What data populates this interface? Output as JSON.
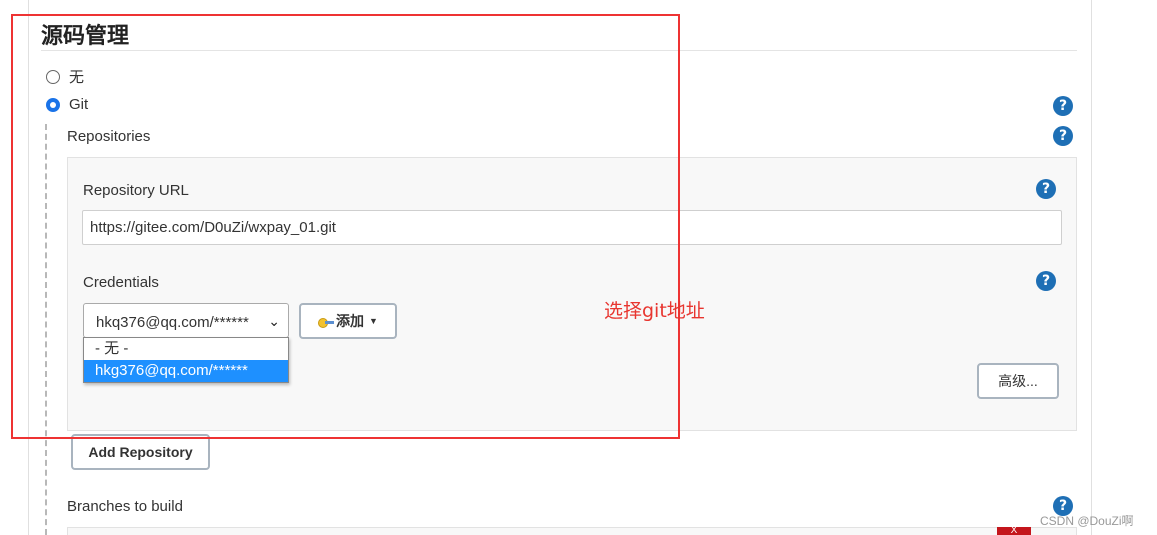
{
  "section": {
    "title": "源码管理"
  },
  "scm_options": [
    {
      "label": "无",
      "selected": false
    },
    {
      "label": "Git",
      "selected": true
    }
  ],
  "repositories": {
    "label": "Repositories",
    "url_label": "Repository URL",
    "url_value": "https://gitee.com/D0uZi/wxpay_01.git",
    "credentials_label": "Credentials",
    "credentials_selected": "hkq376@qq.com/******",
    "credentials_options": [
      "- 无 -",
      "hkg376@qq.com/******"
    ],
    "add_button_label": "添加",
    "advanced_button_label": "高级...",
    "add_repository_label": "Add Repository"
  },
  "branches": {
    "label": "Branches to build",
    "delete_label": "X"
  },
  "help_icon_glyph": "?",
  "annotation_text": "选择git地址",
  "watermark": "CSDN @DouZi啊",
  "colors": {
    "help": "#1e6fb5",
    "annotation": "#e8352f",
    "selected_option": "#1e90ff",
    "delete": "#c4161c"
  }
}
